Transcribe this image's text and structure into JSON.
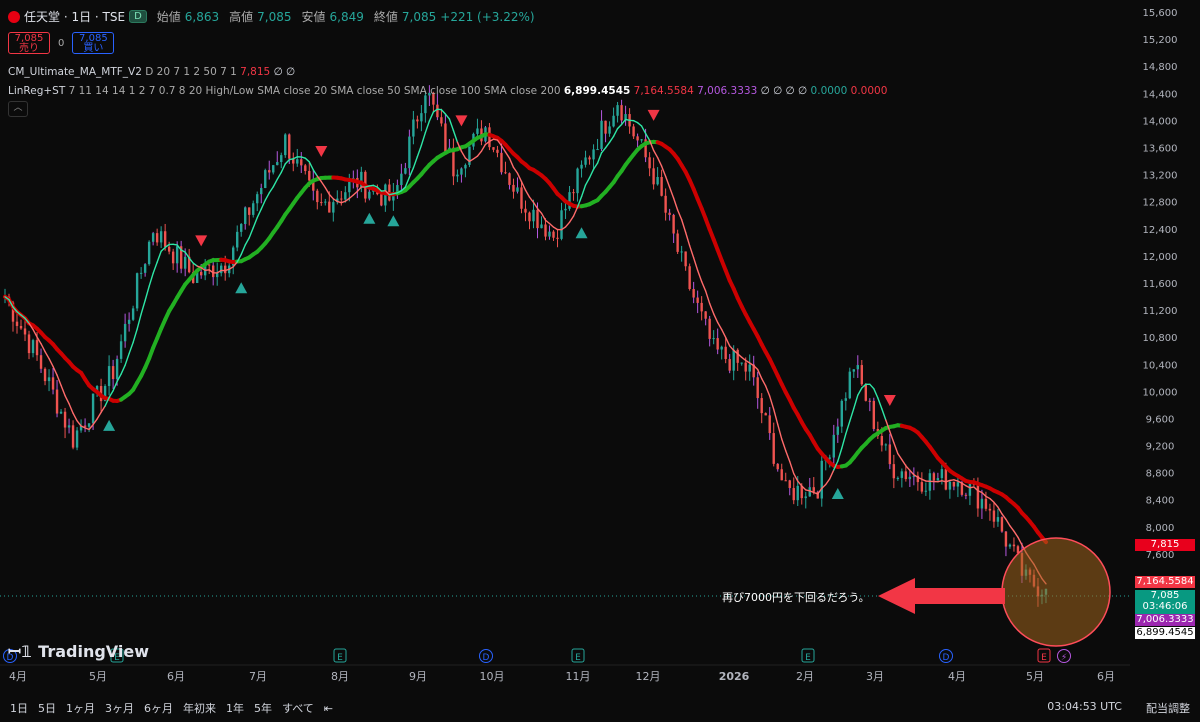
{
  "header": {
    "ticker": "任天堂 · 1日 · TSE",
    "d_badge": "D",
    "open_label": "始値",
    "open": "6,863",
    "high_label": "高値",
    "high": "7,085",
    "low_label": "安値",
    "low": "6,849",
    "close_label": "終値",
    "close": "7,085",
    "change": "+221 (+3.22%)"
  },
  "trade": {
    "sell_price": "7,085",
    "sell_label": "売り",
    "spread": "0",
    "buy_price": "7,085",
    "buy_label": "買い"
  },
  "indicators": {
    "cm_name": "CM_Ultimate_MA_MTF_V2",
    "cm_params": "D 20 7 1 2 50 7 1",
    "cm_value": "7,815",
    "cm_tail": "∅ ∅",
    "lr_name": "LinReg+ST",
    "lr_params": "7 11 14 14 1 2 7 0.7 8 20 High/Low SMA close 20 SMA close 50 SMA close 100 SMA close 200",
    "lr_v1": "6,899.4545",
    "lr_v2": "7,164.5584",
    "lr_v3": "7,006.3333",
    "lr_tail": "∅ ∅ ∅ ∅",
    "lr_v4": "0.0000",
    "lr_v5": "0.0000"
  },
  "annotation": "再び7000円を下回るだろう。",
  "price_badges": {
    "ma": "7,815",
    "linreg": "7,164.5584",
    "last": "7,085",
    "countdown": "03:46:06",
    "purple": "7,006.3333",
    "white": "6,899.4545"
  },
  "brand": "TradingView",
  "bottom": {
    "ranges": [
      "1日",
      "5日",
      "1ヶ月",
      "3ヶ月",
      "6ヶ月",
      "年初来",
      "1年",
      "5年",
      "すべて"
    ],
    "time": "03:04:53 UTC",
    "adjust": "配当調整"
  },
  "colors": {
    "up": "#26a69a",
    "down": "#ef5350",
    "ma_red": "#cc0000",
    "ma_green": "#22b022",
    "fast": "#ff6b6b",
    "fast_green": "#2ee6a6",
    "marker_down": "#f23645",
    "marker_up": "#26a69a"
  },
  "chart_data": {
    "type": "line",
    "title": "任天堂 · 1日 · TSE",
    "ylim": [
      6300,
      15600
    ],
    "y_ticks": [
      6400,
      6800,
      7200,
      7600,
      8000,
      8400,
      8800,
      9200,
      9600,
      10000,
      10400,
      10800,
      11200,
      11600,
      12000,
      12400,
      12800,
      13200,
      13600,
      14000,
      14400,
      14800,
      15200,
      15600
    ],
    "x_labels": [
      "4月",
      "5月",
      "6月",
      "7月",
      "8月",
      "9月",
      "10月",
      "11月",
      "12月",
      "2026",
      "2月",
      "3月",
      "4月",
      "5月",
      "6月"
    ],
    "event_badges": [
      "D",
      "E",
      "E",
      "D",
      "E",
      "D",
      "E",
      "E",
      "D",
      "E",
      "E"
    ],
    "x": [
      0,
      8,
      17,
      27,
      37,
      47,
      55,
      62,
      70,
      78,
      88,
      97,
      105,
      112,
      120,
      128,
      137,
      145,
      153,
      162,
      170,
      177,
      186,
      195,
      203,
      212,
      221,
      229,
      238,
      246,
      255,
      260
    ],
    "series": [
      {
        "name": "close",
        "values": [
          11400,
          10500,
          9300,
          10300,
          12400,
          11700,
          11900,
          12800,
          13700,
          12700,
          13100,
          12800,
          14500,
          13300,
          13900,
          12900,
          12300,
          13400,
          14300,
          13200,
          11700,
          10600,
          10300,
          8500,
          8600,
          10400,
          8900,
          8700,
          8700,
          8300,
          7200,
          7085
        ]
      }
    ]
  }
}
